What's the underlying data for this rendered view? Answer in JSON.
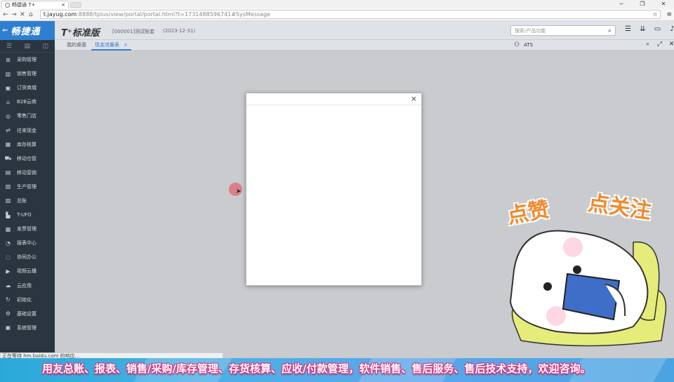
{
  "browser": {
    "tab_title": "畅捷通 T+",
    "tab_close": "×",
    "window_controls": [
      "─",
      "❐",
      "✕"
    ],
    "url_host": "t.jayug.com",
    "url_rest": ":8888/tplus/view/portal/portal.html?t=1731488596741#SysMessage",
    "nav": {
      "back": "←",
      "forward": "→",
      "stop": "✕",
      "home": "⌂"
    },
    "menu_icon": "≡"
  },
  "header": {
    "brand_arrow": "⇐",
    "brand_name": "畅捷通",
    "product_name": "T⁺标准版",
    "company": "[000001]测试账套",
    "date": "(2023-12-31)",
    "search_placeholder": "搜索/产品功能",
    "search_icon": "⌕",
    "icons": [
      "☰",
      "⇊",
      "▭",
      "♪",
      "?"
    ]
  },
  "sidebar": {
    "top_icons": [
      "☰",
      "▤",
      "◫"
    ],
    "items": [
      {
        "label": "采购管理",
        "icon": "cart-icon",
        "glyph": "⊞"
      },
      {
        "label": "销售管理",
        "icon": "chart-icon",
        "glyph": "▥"
      },
      {
        "label": "订货商城",
        "icon": "store-icon",
        "glyph": "▣"
      },
      {
        "label": "B2B云商",
        "icon": "cloud-store-icon",
        "glyph": "⌂"
      },
      {
        "label": "零售门店",
        "icon": "pos-icon",
        "glyph": "◎"
      },
      {
        "label": "往来现金",
        "icon": "exchange-icon",
        "glyph": "⇄"
      },
      {
        "label": "库存核算",
        "icon": "inventory-icon",
        "glyph": "▦"
      },
      {
        "label": "移动仓管",
        "icon": "truck-icon",
        "glyph": "⛟"
      },
      {
        "label": "移动营销",
        "icon": "mobile-marketing-icon",
        "glyph": "▤"
      },
      {
        "label": "生产管理",
        "icon": "factory-icon",
        "glyph": "▨"
      },
      {
        "label": "总账",
        "icon": "ledger-icon",
        "glyph": "▧"
      },
      {
        "label": "T-UFO",
        "icon": "report-icon",
        "glyph": "▙"
      },
      {
        "label": "发票管理",
        "icon": "invoice-icon",
        "glyph": "▩"
      },
      {
        "label": "报表中心",
        "icon": "report-center-icon",
        "glyph": "◔"
      },
      {
        "label": "协同办公",
        "icon": "collab-icon",
        "glyph": "◌"
      },
      {
        "label": "视频云播",
        "icon": "video-icon",
        "glyph": "▶"
      },
      {
        "label": "云应用",
        "icon": "cloud-app-icon",
        "glyph": "☁"
      },
      {
        "label": "初始化",
        "icon": "init-icon",
        "glyph": "↻"
      },
      {
        "label": "基础设置",
        "icon": "settings-icon",
        "glyph": "⚙"
      },
      {
        "label": "系统管理",
        "icon": "system-icon",
        "glyph": "▣"
      }
    ]
  },
  "tabs": [
    {
      "label": "我的桌面",
      "active": false
    },
    {
      "label": "现金流量表",
      "active": true,
      "close": "×"
    }
  ],
  "user": {
    "name": "ATS",
    "icon_glyph": "⚇"
  },
  "tab_tools": [
    "⌕",
    "⤢",
    "✕"
  ],
  "dialog": {
    "close": "×"
  },
  "status_text": "正在等待 hm.baidu.com 的响应...",
  "banner_text": "用友总账、报表、销售/采购/库存管理、存货核算、应收/付款管理，软件销售、售后服务、售后技术支持，欢迎咨询。",
  "sticker": {
    "left_text": "点赞",
    "right_text": "点关注"
  },
  "colors": {
    "brand": "#2f7fd0",
    "sidebar": "#2b3540",
    "banner": "#4ab0e6",
    "banner_outline": "#d6337e",
    "sticker_text": "#f08a2c"
  }
}
